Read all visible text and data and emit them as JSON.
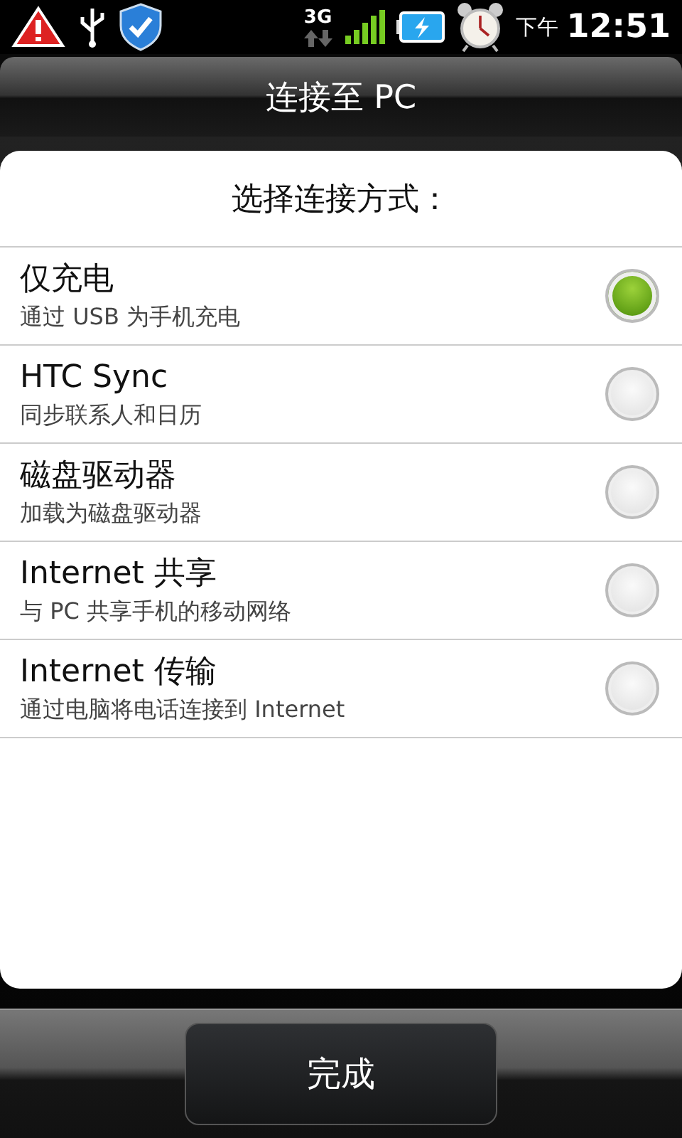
{
  "status_bar": {
    "network": "3G",
    "period": "下午",
    "time": "12:51"
  },
  "title_bar": {
    "title": "连接至 PC"
  },
  "dialog": {
    "heading": "选择连接方式：",
    "options": [
      {
        "title": "仅充电",
        "subtitle": "通过 USB 为手机充电",
        "selected": true
      },
      {
        "title": "HTC Sync",
        "subtitle": "同步联系人和日历",
        "selected": false
      },
      {
        "title": "磁盘驱动器",
        "subtitle": "加载为磁盘驱动器",
        "selected": false
      },
      {
        "title": "Internet 共享",
        "subtitle": "与 PC 共享手机的移动网络",
        "selected": false
      },
      {
        "title": "Internet 传输",
        "subtitle": "通过电脑将电话连接到 Internet",
        "selected": false
      }
    ]
  },
  "buttons": [
    "完成"
  ]
}
